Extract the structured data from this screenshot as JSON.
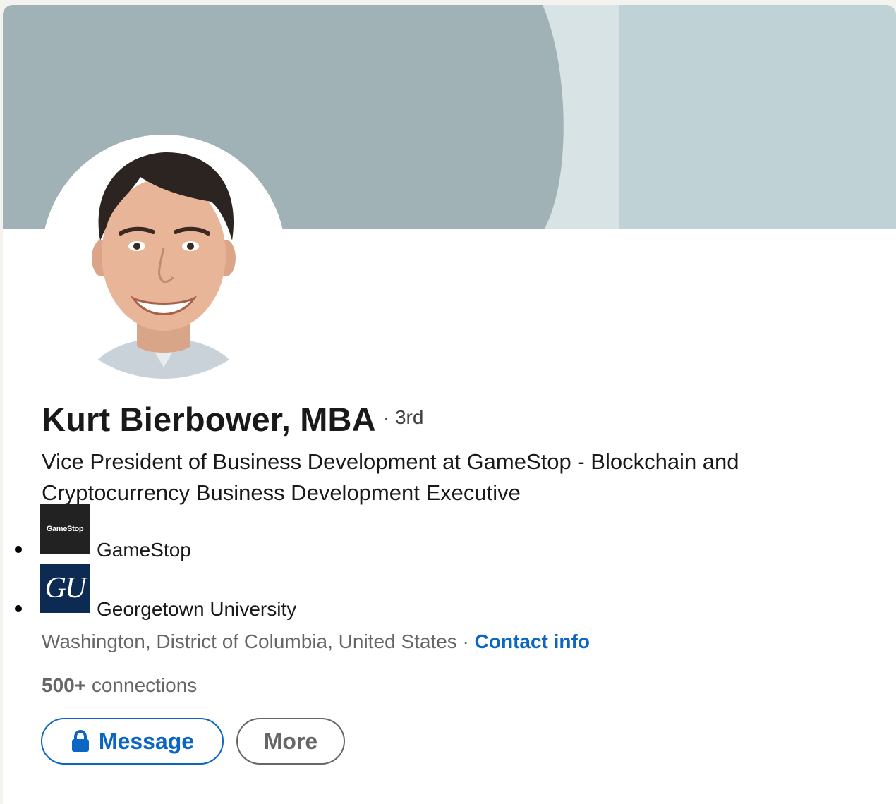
{
  "profile": {
    "name": "Kurt Bierbower, MBA",
    "degree": "· 3rd",
    "headline": "Vice President of Business Development at GameStop - Blockchain and Cryptocurrency Business Development Executive",
    "organizations": [
      {
        "name": "GameStop",
        "logo_text": "GameStop",
        "logo_icon": "gamestop-logo-icon"
      },
      {
        "name": "Georgetown University",
        "logo_text": "GU",
        "logo_icon": "georgetown-logo-icon"
      }
    ],
    "location": "Washington, District of Columbia, United States",
    "location_separator": " · ",
    "contact_info_label": "Contact info",
    "connections_count": "500+",
    "connections_label": " connections"
  },
  "actions": {
    "message_label": "Message",
    "message_icon": "lock-icon",
    "more_label": "More"
  },
  "colors": {
    "accent": "#0a66c2",
    "banner_left": "#a0b2b6",
    "banner_stripe": "#d8e3e5",
    "banner_right": "#bfd3d7"
  }
}
